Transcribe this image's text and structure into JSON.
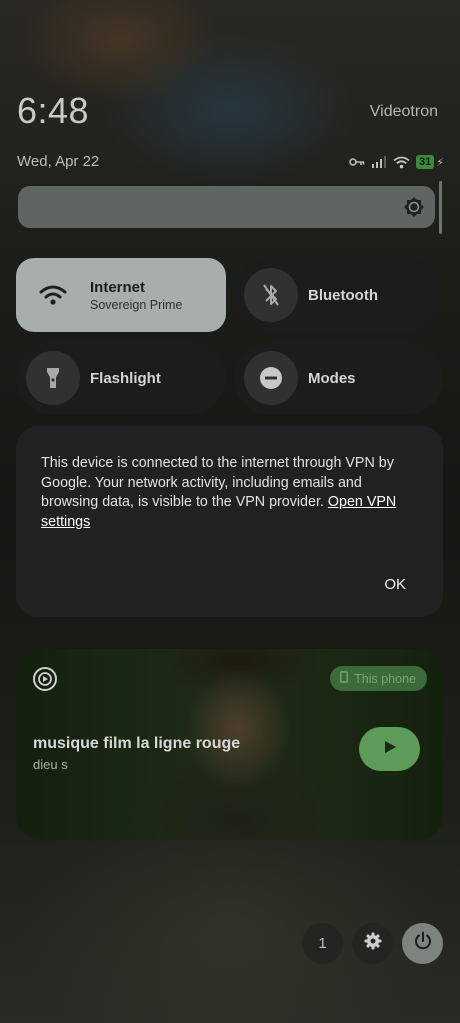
{
  "status_bar": {
    "time": "6:48",
    "carrier": "Videotron",
    "date": "Wed, Apr 22",
    "battery": "31",
    "icons": [
      "vpn-key-icon",
      "signal-icon",
      "wifi-icon",
      "battery-icon",
      "charging-icon"
    ]
  },
  "brightness": {
    "icon": "brightness-icon",
    "level": 0.98
  },
  "tiles": [
    {
      "label": "Internet",
      "sublabel": "Sovereign Prime",
      "icon": "wifi-icon",
      "state": "on"
    },
    {
      "label": "Bluetooth",
      "icon": "bluetooth-off-icon",
      "state": "off"
    },
    {
      "label": "Flashlight",
      "icon": "flashlight-icon",
      "state": "off"
    },
    {
      "label": "Modes",
      "icon": "do-not-disturb-icon",
      "state": "off"
    }
  ],
  "vpn_dialog": {
    "message": "This device is connected to the internet through VPN by Google. Your network activity, including emails and browsing data, is visible to the VPN provider.",
    "link_text": "Open VPN settings",
    "ok_label": "OK"
  },
  "media": {
    "source_icon": "media-app-icon",
    "output_device": "This phone",
    "title": "musique film la ligne rouge",
    "artist": "dieu s",
    "play_icon": "play-icon"
  },
  "footer": {
    "user_count": "1",
    "settings_icon": "gear-icon",
    "power_icon": "power-icon"
  },
  "colors": {
    "tile_on": "#a8aeac",
    "tile_off": "#1b1c1b",
    "dialog_bg": "#202221",
    "media_accent": "#5c9b58",
    "battery_green": "#3c8a3e"
  }
}
